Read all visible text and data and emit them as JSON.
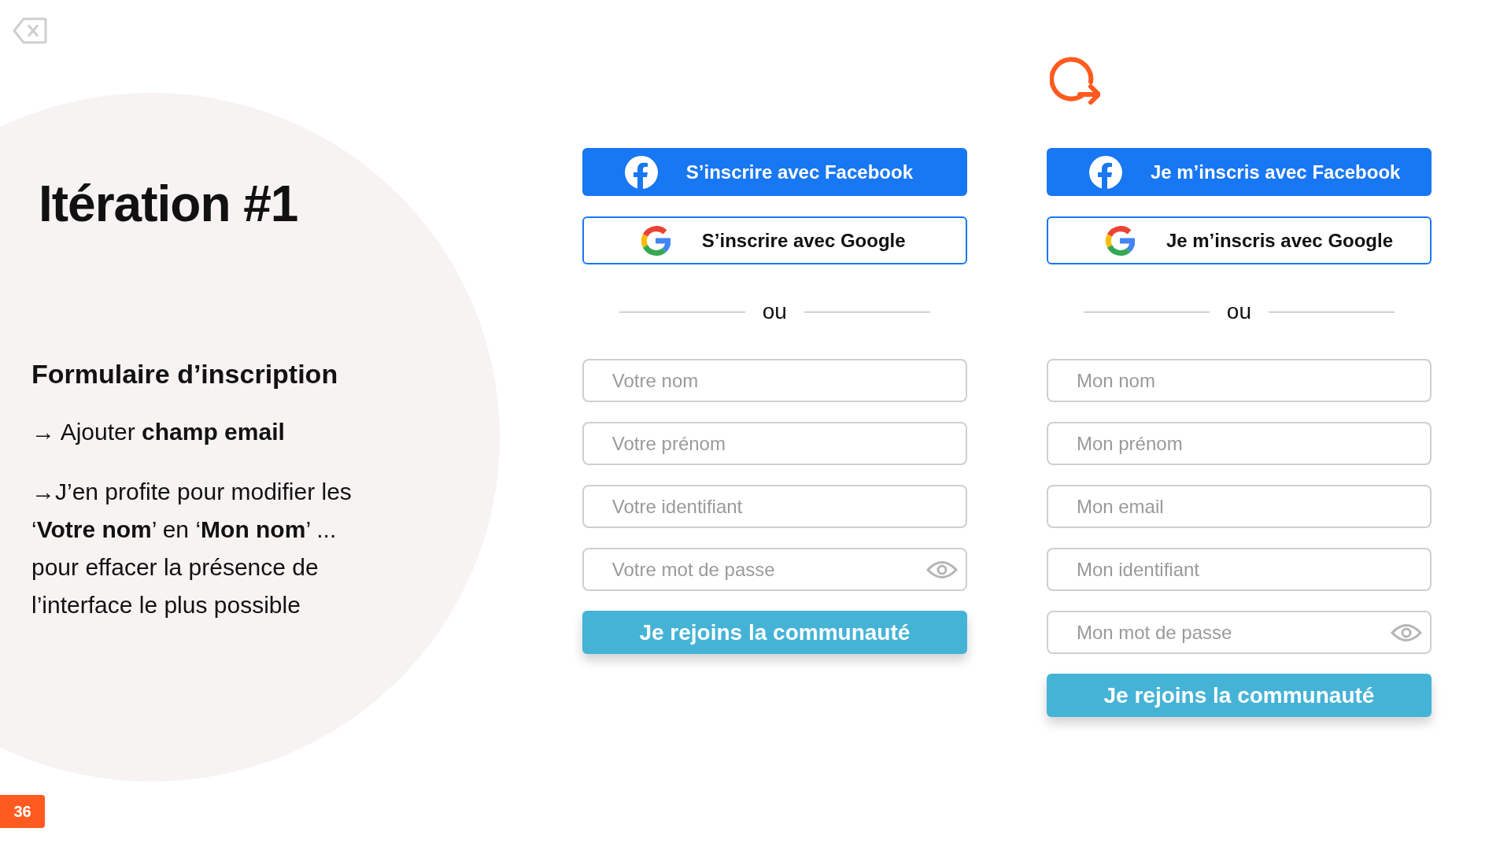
{
  "slide": {
    "title": "Itération #1",
    "heading": "Formulaire d’inscription",
    "points": [
      "→ Ajouter **champ email**",
      "→J’en profite pour modifier les ‘**Votre nom**’ en ‘**Mon nom**’ ... pour effacer la présence de l’interface le plus possible"
    ],
    "page_number": "36"
  },
  "forms": [
    {
      "social_buttons": [
        {
          "kind": "facebook",
          "label": "S’inscrire avec Facebook"
        },
        {
          "kind": "google",
          "label": "S’inscrire avec Google"
        }
      ],
      "separator": "ou",
      "fields": [
        {
          "kind": "text",
          "placeholder": "Votre nom"
        },
        {
          "kind": "text",
          "placeholder": "Votre prénom"
        },
        {
          "kind": "text",
          "placeholder": "Votre identifiant"
        },
        {
          "kind": "password",
          "placeholder": "Votre mot de passe"
        }
      ],
      "submit": "Je rejoins la communauté"
    },
    {
      "social_buttons": [
        {
          "kind": "facebook",
          "label": "Je m’inscris avec Facebook"
        },
        {
          "kind": "google",
          "label": "Je m’inscris avec Google"
        }
      ],
      "separator": "ou",
      "fields": [
        {
          "kind": "text",
          "placeholder": "Mon nom"
        },
        {
          "kind": "text",
          "placeholder": "Mon prénom"
        },
        {
          "kind": "text",
          "placeholder": "Mon email"
        },
        {
          "kind": "text",
          "placeholder": "Mon identifiant"
        },
        {
          "kind": "password",
          "placeholder": "Mon mot de passe"
        }
      ],
      "submit": "Je rejoins la communauté"
    }
  ]
}
